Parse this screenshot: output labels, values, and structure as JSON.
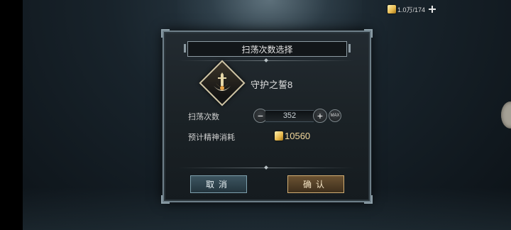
{
  "resource": {
    "value": "1.0万/174",
    "coin_icon": "spirit-coin-icon",
    "add_icon": "plus-icon"
  },
  "dialog": {
    "title": "扫荡次数选择",
    "item": {
      "name": "守护之誓8",
      "icon": "sword-emblem-icon"
    },
    "sweep": {
      "label": "扫荡次数",
      "value": "352",
      "minus_icon": "minus-icon",
      "plus_icon": "plus-icon",
      "max_label": "MAX"
    },
    "cost": {
      "label": "预计精神消耗",
      "value": "10560",
      "icon": "spirit-coin-icon"
    },
    "buttons": {
      "cancel": "取消",
      "confirm": "确认"
    }
  },
  "colors": {
    "confirm_accent": "#d2ae73",
    "cancel_accent": "#7ea0ad",
    "cost_text": "#f2d79b"
  }
}
